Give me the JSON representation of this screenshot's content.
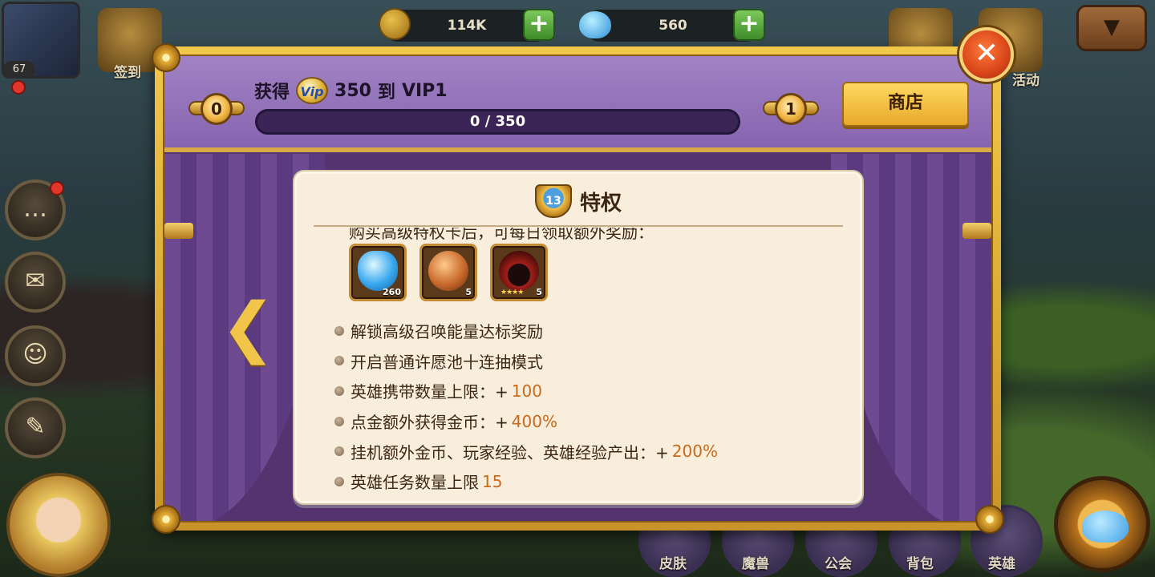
{
  "top_bar": {
    "gold": "114K",
    "gems": "560",
    "player_level": "67",
    "checkin_label": "签到",
    "events_label": "活动"
  },
  "bottom_nav": {
    "items": [
      {
        "label": "皮肤"
      },
      {
        "label": "魔兽"
      },
      {
        "label": "公会"
      },
      {
        "label": "背包"
      },
      {
        "label": "英雄"
      }
    ]
  },
  "vip_modal": {
    "gain_prefix": "获得",
    "vip_points": "350",
    "to_word": "到",
    "target_vip": "VIP1",
    "vip_icon_text": "Vip",
    "current_level": "0",
    "next_level": "1",
    "progress_text": "0 / 350",
    "progress_fraction": 0,
    "shop_button": "商店",
    "close_symbol": "✕",
    "nav_prev_symbol": "❮",
    "privilege": {
      "title": "特权",
      "shield_number": "13",
      "cut_off_top_text": "购买高级特权卡后，可每日领取额外奖励：",
      "rewards": [
        {
          "icon": "diamond-icon",
          "qty": "260"
        },
        {
          "icon": "bronze-medal-icon",
          "qty": "5"
        },
        {
          "icon": "hero-shard-icon",
          "qty": "5",
          "stars": "★★★★"
        }
      ],
      "perks": [
        {
          "text": "解锁高级召唤能量达标奖励",
          "value": ""
        },
        {
          "text": "开启普通许愿池十连抽模式",
          "value": ""
        },
        {
          "text": "英雄携带数量上限：+",
          "value": "100"
        },
        {
          "text": "点金额外获得金币：+",
          "value": "400%"
        },
        {
          "text": "挂机额外金币、玩家经验、英雄经验产出：+",
          "value": "200%"
        },
        {
          "text": "英雄任务数量上限",
          "value": "15"
        }
      ]
    }
  },
  "colors": {
    "modal_purple": "#54336f",
    "header_purple": "#8764b0",
    "gold_frame": "#f1c84a",
    "card_bg": "#f8eedb",
    "value_orange": "#c76a1e",
    "close_red": "#d8451a"
  }
}
